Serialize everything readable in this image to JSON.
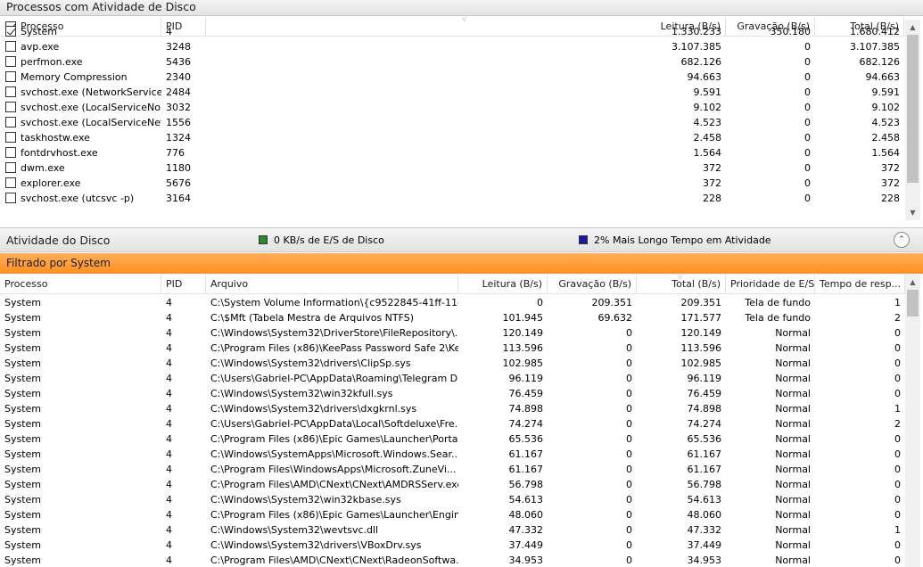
{
  "top": {
    "title": "Processos com Atividade de Disco",
    "columns": {
      "process": "Processo",
      "pid": "PID",
      "read": "Leitura (B/s)",
      "write": "Gravação (B/s)",
      "total": "Total (B/s)"
    },
    "rows": [
      {
        "checked": true,
        "name": "System",
        "pid": "4",
        "read": "1.330.233",
        "write": "350.180",
        "total": "1.680.412"
      },
      {
        "checked": false,
        "name": "avp.exe",
        "pid": "3248",
        "read": "3.107.385",
        "write": "0",
        "total": "3.107.385"
      },
      {
        "checked": false,
        "name": "perfmon.exe",
        "pid": "5436",
        "read": "682.126",
        "write": "0",
        "total": "682.126"
      },
      {
        "checked": false,
        "name": "Memory Compression",
        "pid": "2340",
        "read": "94.663",
        "write": "0",
        "total": "94.663"
      },
      {
        "checked": false,
        "name": "svchost.exe (NetworkService...",
        "pid": "2484",
        "read": "9.591",
        "write": "0",
        "total": "9.591"
      },
      {
        "checked": false,
        "name": "svchost.exe (LocalServiceNo...",
        "pid": "3032",
        "read": "9.102",
        "write": "0",
        "total": "9.102"
      },
      {
        "checked": false,
        "name": "svchost.exe (LocalServiceNet...",
        "pid": "1556",
        "read": "4.523",
        "write": "0",
        "total": "4.523"
      },
      {
        "checked": false,
        "name": "taskhostw.exe",
        "pid": "1324",
        "read": "2.458",
        "write": "0",
        "total": "2.458"
      },
      {
        "checked": false,
        "name": "fontdrvhost.exe",
        "pid": "776",
        "read": "1.564",
        "write": "0",
        "total": "1.564"
      },
      {
        "checked": false,
        "name": "dwm.exe",
        "pid": "1180",
        "read": "372",
        "write": "0",
        "total": "372"
      },
      {
        "checked": false,
        "name": "explorer.exe",
        "pid": "5676",
        "read": "372",
        "write": "0",
        "total": "372"
      },
      {
        "checked": false,
        "name": "svchost.exe (utcsvc -p)",
        "pid": "3164",
        "read": "228",
        "write": "0",
        "total": "228"
      }
    ]
  },
  "disk": {
    "title": "Atividade do Disco",
    "legend_io": "0 KB/s de E/S de Disco",
    "legend_active": "2% Mais Longo Tempo em Atividade",
    "io_color": "#2a8a2a",
    "active_color": "#1a1aaa"
  },
  "filter": {
    "label": "Filtrado por System"
  },
  "bottom": {
    "columns": {
      "process": "Processo",
      "pid": "PID",
      "file": "Arquivo",
      "read": "Leitura (B/s)",
      "write": "Gravação (B/s)",
      "total": "Total (B/s)",
      "priority": "Prioridade de E/S",
      "response": "Tempo de resp..."
    },
    "rows": [
      {
        "name": "System",
        "pid": "4",
        "file": "C:\\System Volume Information\\{c9522845-41ff-11e...",
        "read": "0",
        "write": "209.351",
        "total": "209.351",
        "priority": "Tela de fundo",
        "response": "1"
      },
      {
        "name": "System",
        "pid": "4",
        "file": "C:\\$Mft (Tabela Mestra de Arquivos NTFS)",
        "read": "101.945",
        "write": "69.632",
        "total": "171.577",
        "priority": "Tela de fundo",
        "response": "2"
      },
      {
        "name": "System",
        "pid": "4",
        "file": "C:\\Windows\\System32\\DriverStore\\FileRepository\\...",
        "read": "120.149",
        "write": "0",
        "total": "120.149",
        "priority": "Normal",
        "response": "0"
      },
      {
        "name": "System",
        "pid": "4",
        "file": "C:\\Program Files (x86)\\KeePass Password Safe 2\\Ke...",
        "read": "113.596",
        "write": "0",
        "total": "113.596",
        "priority": "Normal",
        "response": "0"
      },
      {
        "name": "System",
        "pid": "4",
        "file": "C:\\Windows\\System32\\drivers\\ClipSp.sys",
        "read": "102.985",
        "write": "0",
        "total": "102.985",
        "priority": "Normal",
        "response": "0"
      },
      {
        "name": "System",
        "pid": "4",
        "file": "C:\\Users\\Gabriel-PC\\AppData\\Roaming\\Telegram D...",
        "read": "96.119",
        "write": "0",
        "total": "96.119",
        "priority": "Normal",
        "response": "0"
      },
      {
        "name": "System",
        "pid": "4",
        "file": "C:\\Windows\\System32\\win32kfull.sys",
        "read": "76.459",
        "write": "0",
        "total": "76.459",
        "priority": "Normal",
        "response": "0"
      },
      {
        "name": "System",
        "pid": "4",
        "file": "C:\\Windows\\System32\\drivers\\dxgkrnl.sys",
        "read": "74.898",
        "write": "0",
        "total": "74.898",
        "priority": "Normal",
        "response": "1"
      },
      {
        "name": "System",
        "pid": "4",
        "file": "C:\\Users\\Gabriel-PC\\AppData\\Local\\Softdeluxe\\Fre...",
        "read": "74.274",
        "write": "0",
        "total": "74.274",
        "priority": "Normal",
        "response": "2"
      },
      {
        "name": "System",
        "pid": "4",
        "file": "C:\\Program Files (x86)\\Epic Games\\Launcher\\Portal\\...",
        "read": "65.536",
        "write": "0",
        "total": "65.536",
        "priority": "Normal",
        "response": "0"
      },
      {
        "name": "System",
        "pid": "4",
        "file": "C:\\Windows\\SystemApps\\Microsoft.Windows.Sear...",
        "read": "61.167",
        "write": "0",
        "total": "61.167",
        "priority": "Normal",
        "response": "0"
      },
      {
        "name": "System",
        "pid": "4",
        "file": "C:\\Program Files\\WindowsApps\\Microsoft.ZuneVi...",
        "read": "61.167",
        "write": "0",
        "total": "61.167",
        "priority": "Normal",
        "response": "0"
      },
      {
        "name": "System",
        "pid": "4",
        "file": "C:\\Program Files\\AMD\\CNext\\CNext\\AMDRSServ.exe",
        "read": "56.798",
        "write": "0",
        "total": "56.798",
        "priority": "Normal",
        "response": "0"
      },
      {
        "name": "System",
        "pid": "4",
        "file": "C:\\Windows\\System32\\win32kbase.sys",
        "read": "54.613",
        "write": "0",
        "total": "54.613",
        "priority": "Normal",
        "response": "0"
      },
      {
        "name": "System",
        "pid": "4",
        "file": "C:\\Program Files (x86)\\Epic Games\\Launcher\\Engin...",
        "read": "48.060",
        "write": "0",
        "total": "48.060",
        "priority": "Normal",
        "response": "0"
      },
      {
        "name": "System",
        "pid": "4",
        "file": "C:\\Windows\\System32\\wevtsvc.dll",
        "read": "47.332",
        "write": "0",
        "total": "47.332",
        "priority": "Normal",
        "response": "1"
      },
      {
        "name": "System",
        "pid": "4",
        "file": "C:\\Windows\\System32\\drivers\\VBoxDrv.sys",
        "read": "37.449",
        "write": "0",
        "total": "37.449",
        "priority": "Normal",
        "response": "0"
      },
      {
        "name": "System",
        "pid": "4",
        "file": "C:\\Program Files\\AMD\\CNext\\CNext\\RadeonSoftwa...",
        "read": "34.953",
        "write": "0",
        "total": "34.953",
        "priority": "Normal",
        "response": "0"
      }
    ]
  }
}
